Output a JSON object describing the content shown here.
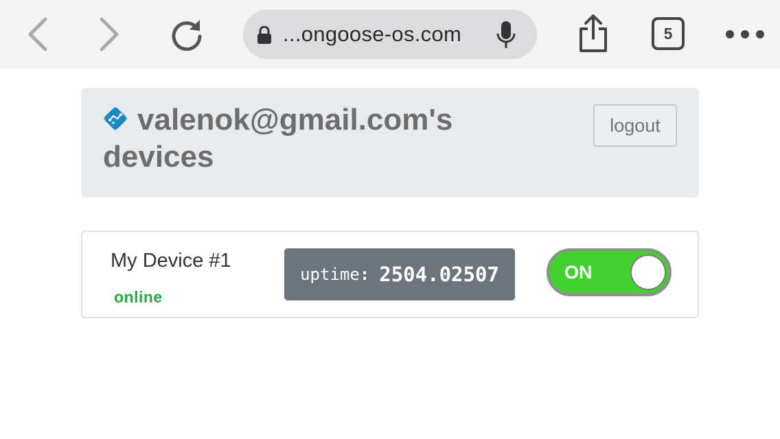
{
  "browser": {
    "url_display": "...ongoose-os.com",
    "tab_count": "5",
    "icons": [
      "chevron-left-icon",
      "chevron-right-icon",
      "reload-icon",
      "lock-icon",
      "microphone-icon",
      "share-icon",
      "more-icon"
    ]
  },
  "header": {
    "title": "valenok@gmail.com's devices",
    "logout_label": "logout",
    "logo_icon": "mongoose-logo-icon",
    "logo_color": "#1b8ac4"
  },
  "device": {
    "name": "My Device #1",
    "status": "online",
    "status_color": "#28a745",
    "uptime_label": "uptime",
    "uptime_separator": ":",
    "uptime_value": "2504.02507",
    "switch_label": "ON",
    "switch_state": true,
    "switch_color": "#42d12f"
  }
}
